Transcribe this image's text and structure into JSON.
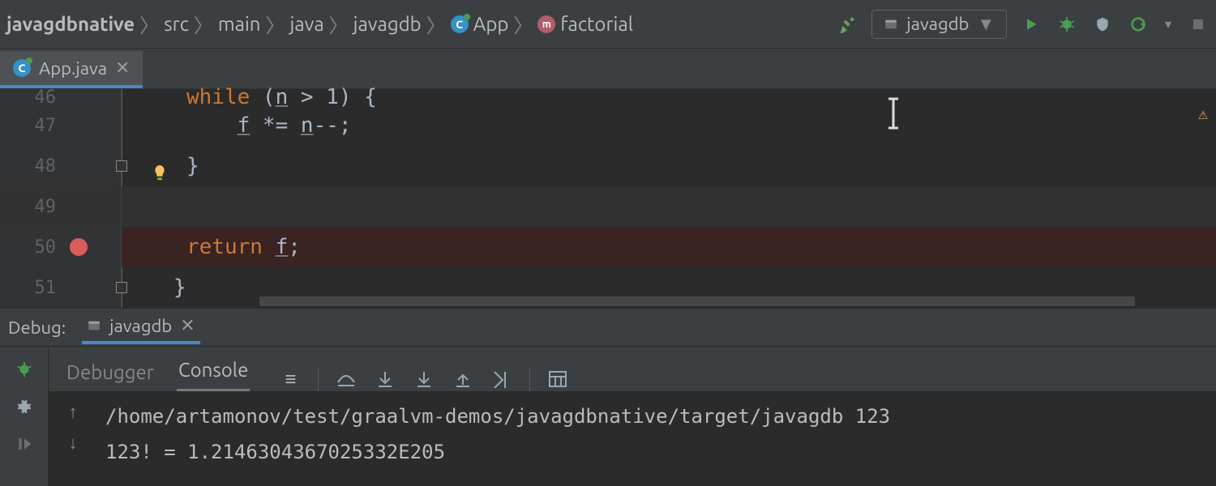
{
  "breadcrumbs": {
    "root": "javagdbnative",
    "p1": "src",
    "p2": "main",
    "p3": "java",
    "p4": "javagdb",
    "class": "App",
    "method": "factorial"
  },
  "run_config": {
    "name": "javagdb"
  },
  "editor_tab": {
    "filename": "App.java"
  },
  "gutter": {
    "l46": "46",
    "l47": "47",
    "l48": "48",
    "l49": "49",
    "l50": "50",
    "l51": "51"
  },
  "code": {
    "l46_kw": "while",
    "l46_rest_a": " (",
    "l46_n": "n",
    "l46_rest_b": " > 1) {",
    "l47_indent": "    ",
    "l47_f": "f",
    "l47_mid": " *= ",
    "l47_n": "n",
    "l47_end": "--;",
    "l48": "}",
    "l50_kw": "return",
    "l50_sp": " ",
    "l50_f": "f",
    "l50_end": ";",
    "l51": "}"
  },
  "debug": {
    "title": "Debug:",
    "config": "javagdb",
    "tab_debugger": "Debugger",
    "tab_console": "Console"
  },
  "console": {
    "line1": "/home/artamonov/test/graalvm-demos/javagdbnative/target/javagdb 123",
    "line2": "123! = 1.2146304367025332E205"
  }
}
